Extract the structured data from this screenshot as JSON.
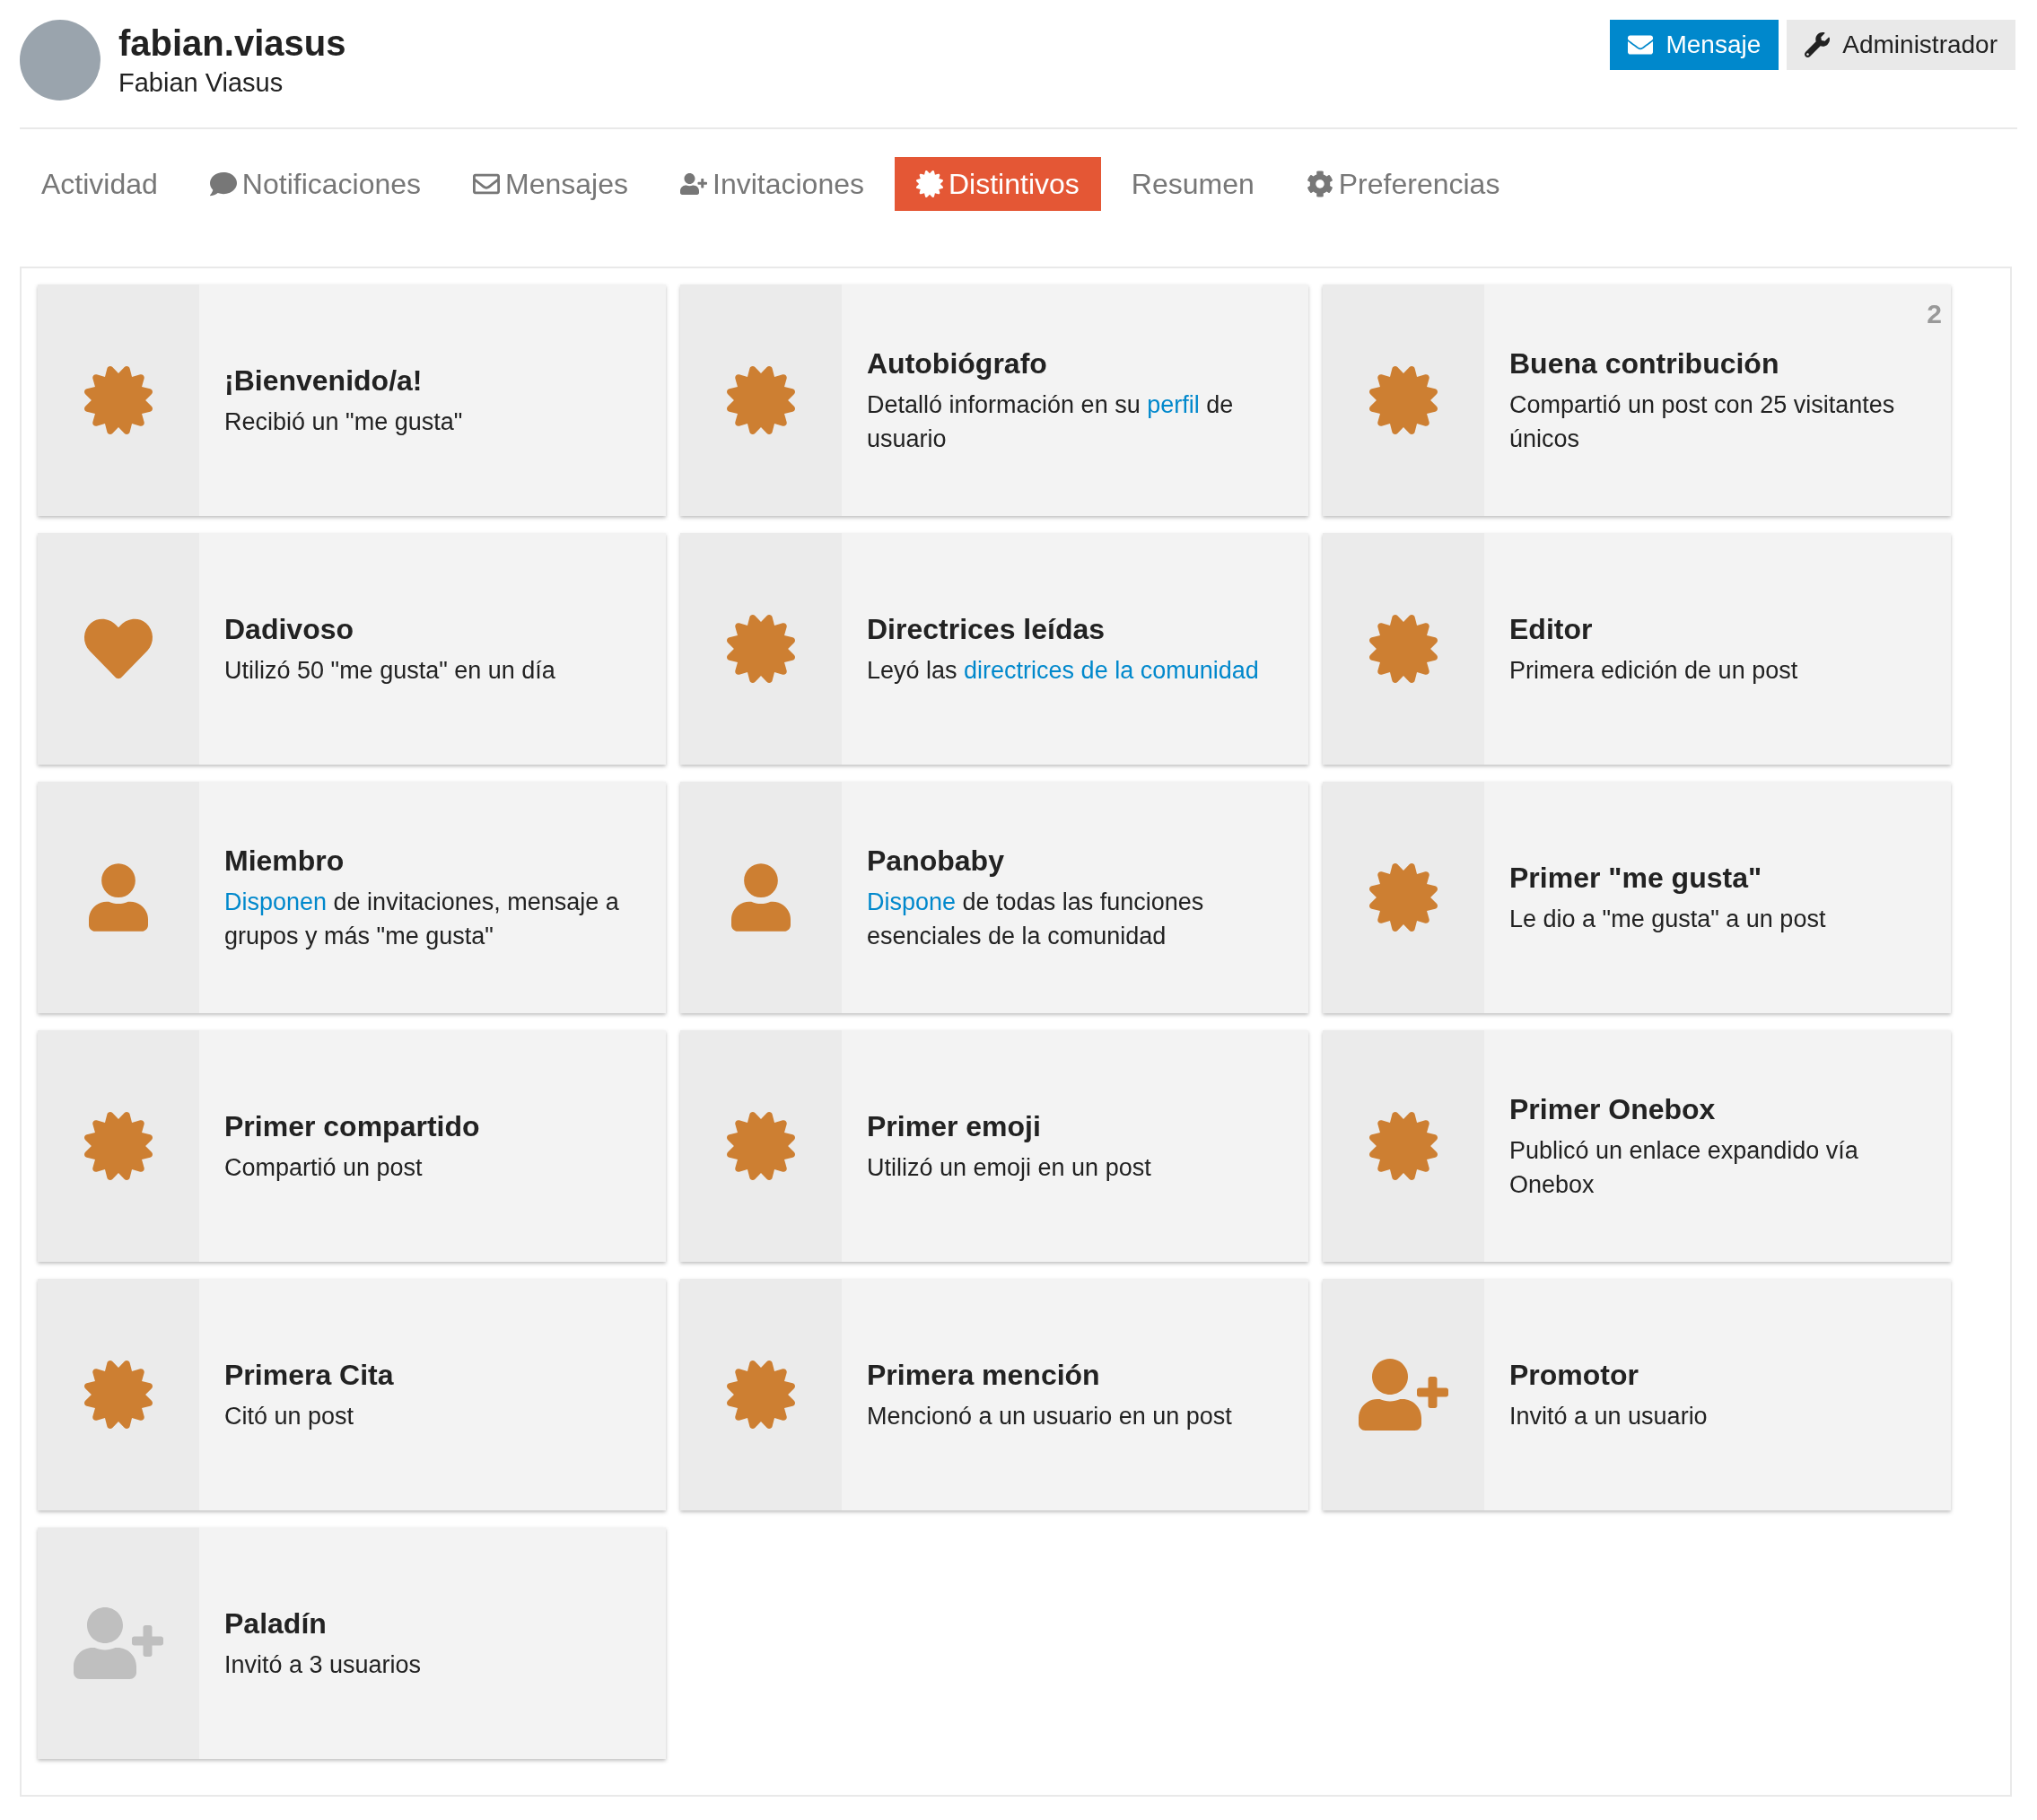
{
  "user": {
    "username": "fabian.viasus",
    "full_name": "Fabian Viasus"
  },
  "actions": [
    {
      "label": "Mensaje",
      "kind": "primary"
    },
    {
      "label": "Administrador",
      "kind": "secondary"
    }
  ],
  "tabs": [
    {
      "label": "Actividad",
      "kind": "plain",
      "selected": false
    },
    {
      "label": "Notificaciones",
      "kind": "comment",
      "selected": false
    },
    {
      "label": "Mensajes",
      "kind": "envelope",
      "selected": false
    },
    {
      "label": "Invitaciones",
      "kind": "user-plus",
      "selected": false
    },
    {
      "label": "Distintivos",
      "kind": "certificate",
      "selected": true
    },
    {
      "label": "Resumen",
      "kind": "plain",
      "selected": false
    },
    {
      "label": "Preferencias",
      "kind": "cog",
      "selected": false
    }
  ],
  "badges": [
    {
      "title": "¡Bienvenido/a!",
      "kind": "certificate",
      "earned": true,
      "description": [
        {
          "text": "Recibió un \"me gusta\"",
          "link": false
        }
      ]
    },
    {
      "title": "Autobiógrafo",
      "kind": "certificate",
      "earned": true,
      "description": [
        {
          "text": "Detalló información en su ",
          "link": false
        },
        {
          "text": "perfil",
          "link": true
        },
        {
          "text": " de usuario",
          "link": false
        }
      ]
    },
    {
      "title": "Buena contribución",
      "kind": "certificate",
      "earned": true,
      "count": "2",
      "description": [
        {
          "text": "Compartió un post con 25 visitantes únicos",
          "link": false
        }
      ]
    },
    {
      "title": "Dadivoso",
      "kind": "heart",
      "earned": true,
      "description": [
        {
          "text": "Utilizó 50 \"me gusta\" en un día",
          "link": false
        }
      ]
    },
    {
      "title": "Directrices leídas",
      "kind": "certificate",
      "earned": true,
      "description": [
        {
          "text": "Leyó las ",
          "link": false
        },
        {
          "text": "directrices de la comunidad",
          "link": true
        }
      ]
    },
    {
      "title": "Editor",
      "kind": "certificate",
      "earned": true,
      "description": [
        {
          "text": "Primera edición de un post",
          "link": false
        }
      ]
    },
    {
      "title": "Miembro",
      "kind": "user",
      "earned": true,
      "description": [
        {
          "text": "Disponen",
          "link": true
        },
        {
          "text": " de invitaciones, mensaje a grupos y más \"me gusta\"",
          "link": false
        }
      ]
    },
    {
      "title": "Panobaby",
      "kind": "user",
      "earned": true,
      "description": [
        {
          "text": "Dispone",
          "link": true
        },
        {
          "text": " de todas las funciones esenciales de la comunidad",
          "link": false
        }
      ]
    },
    {
      "title": "Primer \"me gusta\"",
      "kind": "certificate",
      "earned": true,
      "description": [
        {
          "text": "Le dio a \"me gusta\" a un post",
          "link": false
        }
      ]
    },
    {
      "title": "Primer compartido",
      "kind": "certificate",
      "earned": true,
      "description": [
        {
          "text": "Compartió un post",
          "link": false
        }
      ]
    },
    {
      "title": "Primer emoji",
      "kind": "certificate",
      "earned": true,
      "description": [
        {
          "text": "Utilizó un emoji en un post",
          "link": false
        }
      ]
    },
    {
      "title": "Primer Onebox",
      "kind": "certificate",
      "earned": true,
      "description": [
        {
          "text": "Publicó un enlace expandido vía Onebox",
          "link": false
        }
      ]
    },
    {
      "title": "Primera Cita",
      "kind": "certificate",
      "earned": true,
      "description": [
        {
          "text": "Citó un post",
          "link": false
        }
      ]
    },
    {
      "title": "Primera mención",
      "kind": "certificate",
      "earned": true,
      "description": [
        {
          "text": "Mencionó a un usuario en un post",
          "link": false
        }
      ]
    },
    {
      "title": "Promotor",
      "kind": "user-plus",
      "earned": true,
      "description": [
        {
          "text": "Invitó a un usuario",
          "link": false
        }
      ]
    },
    {
      "title": "Paladín",
      "kind": "user-plus",
      "earned": false,
      "description": [
        {
          "text": "Invitó a 3 usuarios",
          "link": false
        }
      ]
    }
  ]
}
